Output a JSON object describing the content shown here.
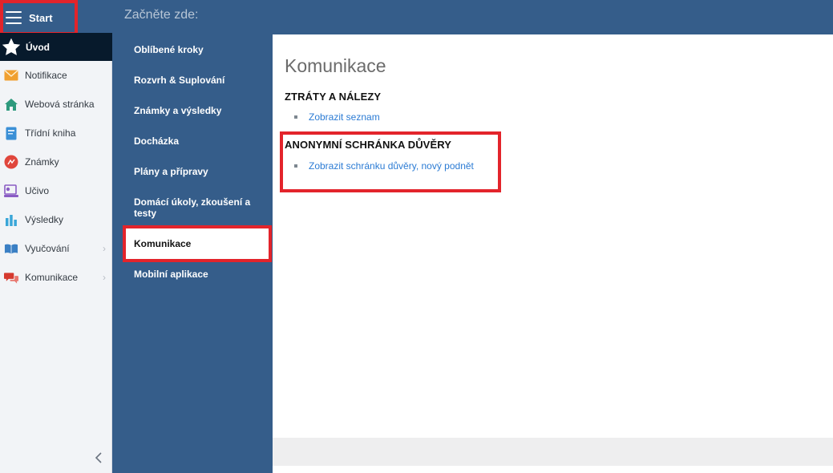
{
  "sidebar": {
    "start_label": "Start",
    "uvod_label": "Úvod",
    "items": [
      {
        "label": "Notifikace",
        "icon": "envelope-icon",
        "color": "#f0a030",
        "chevron": false
      },
      {
        "label": "Webová stránka",
        "icon": "home-icon",
        "color": "#2e9a7d",
        "chevron": false
      },
      {
        "label": "Třídní kniha",
        "icon": "book-icon",
        "color": "#3a8fd6",
        "chevron": false
      },
      {
        "label": "Známky",
        "icon": "grade-icon",
        "color": "#e0463c",
        "chevron": false
      },
      {
        "label": "Učivo",
        "icon": "lesson-icon",
        "color": "#8a5cc4",
        "chevron": false
      },
      {
        "label": "Výsledky",
        "icon": "bar-chart-icon",
        "color": "#3aa6d8",
        "chevron": false
      },
      {
        "label": "Vyučování",
        "icon": "open-book-icon",
        "color": "#3a7fc4",
        "chevron": true
      },
      {
        "label": "Komunikace",
        "icon": "chat-icon",
        "color": "#d5392f",
        "chevron": true
      }
    ]
  },
  "header": {
    "title": "Začněte zde:"
  },
  "midmenu": {
    "items": [
      "Oblíbené kroky",
      "Rozvrh & Suplování",
      "Známky a výsledky",
      "Docházka",
      "Plány a přípravy",
      "Domácí úkoly, zkoušení a testy",
      "Komunikace",
      "Mobilní aplikace"
    ],
    "active_index": 6
  },
  "content": {
    "title": "Komunikace",
    "sections": [
      {
        "heading": "ZTRÁTY A NÁLEZY",
        "link": "Zobrazit seznam"
      },
      {
        "heading": "ANONYMNÍ SCHRÁNKA DŮVĚRY",
        "link": "Zobrazit schránku důvěry, nový podnět"
      }
    ]
  },
  "colors": {
    "brand": "#355d8a",
    "sidebar_bg": "#f2f4f7",
    "active_dark": "#071a2c",
    "link": "#2b7bd4",
    "highlight": "#e3242b"
  }
}
